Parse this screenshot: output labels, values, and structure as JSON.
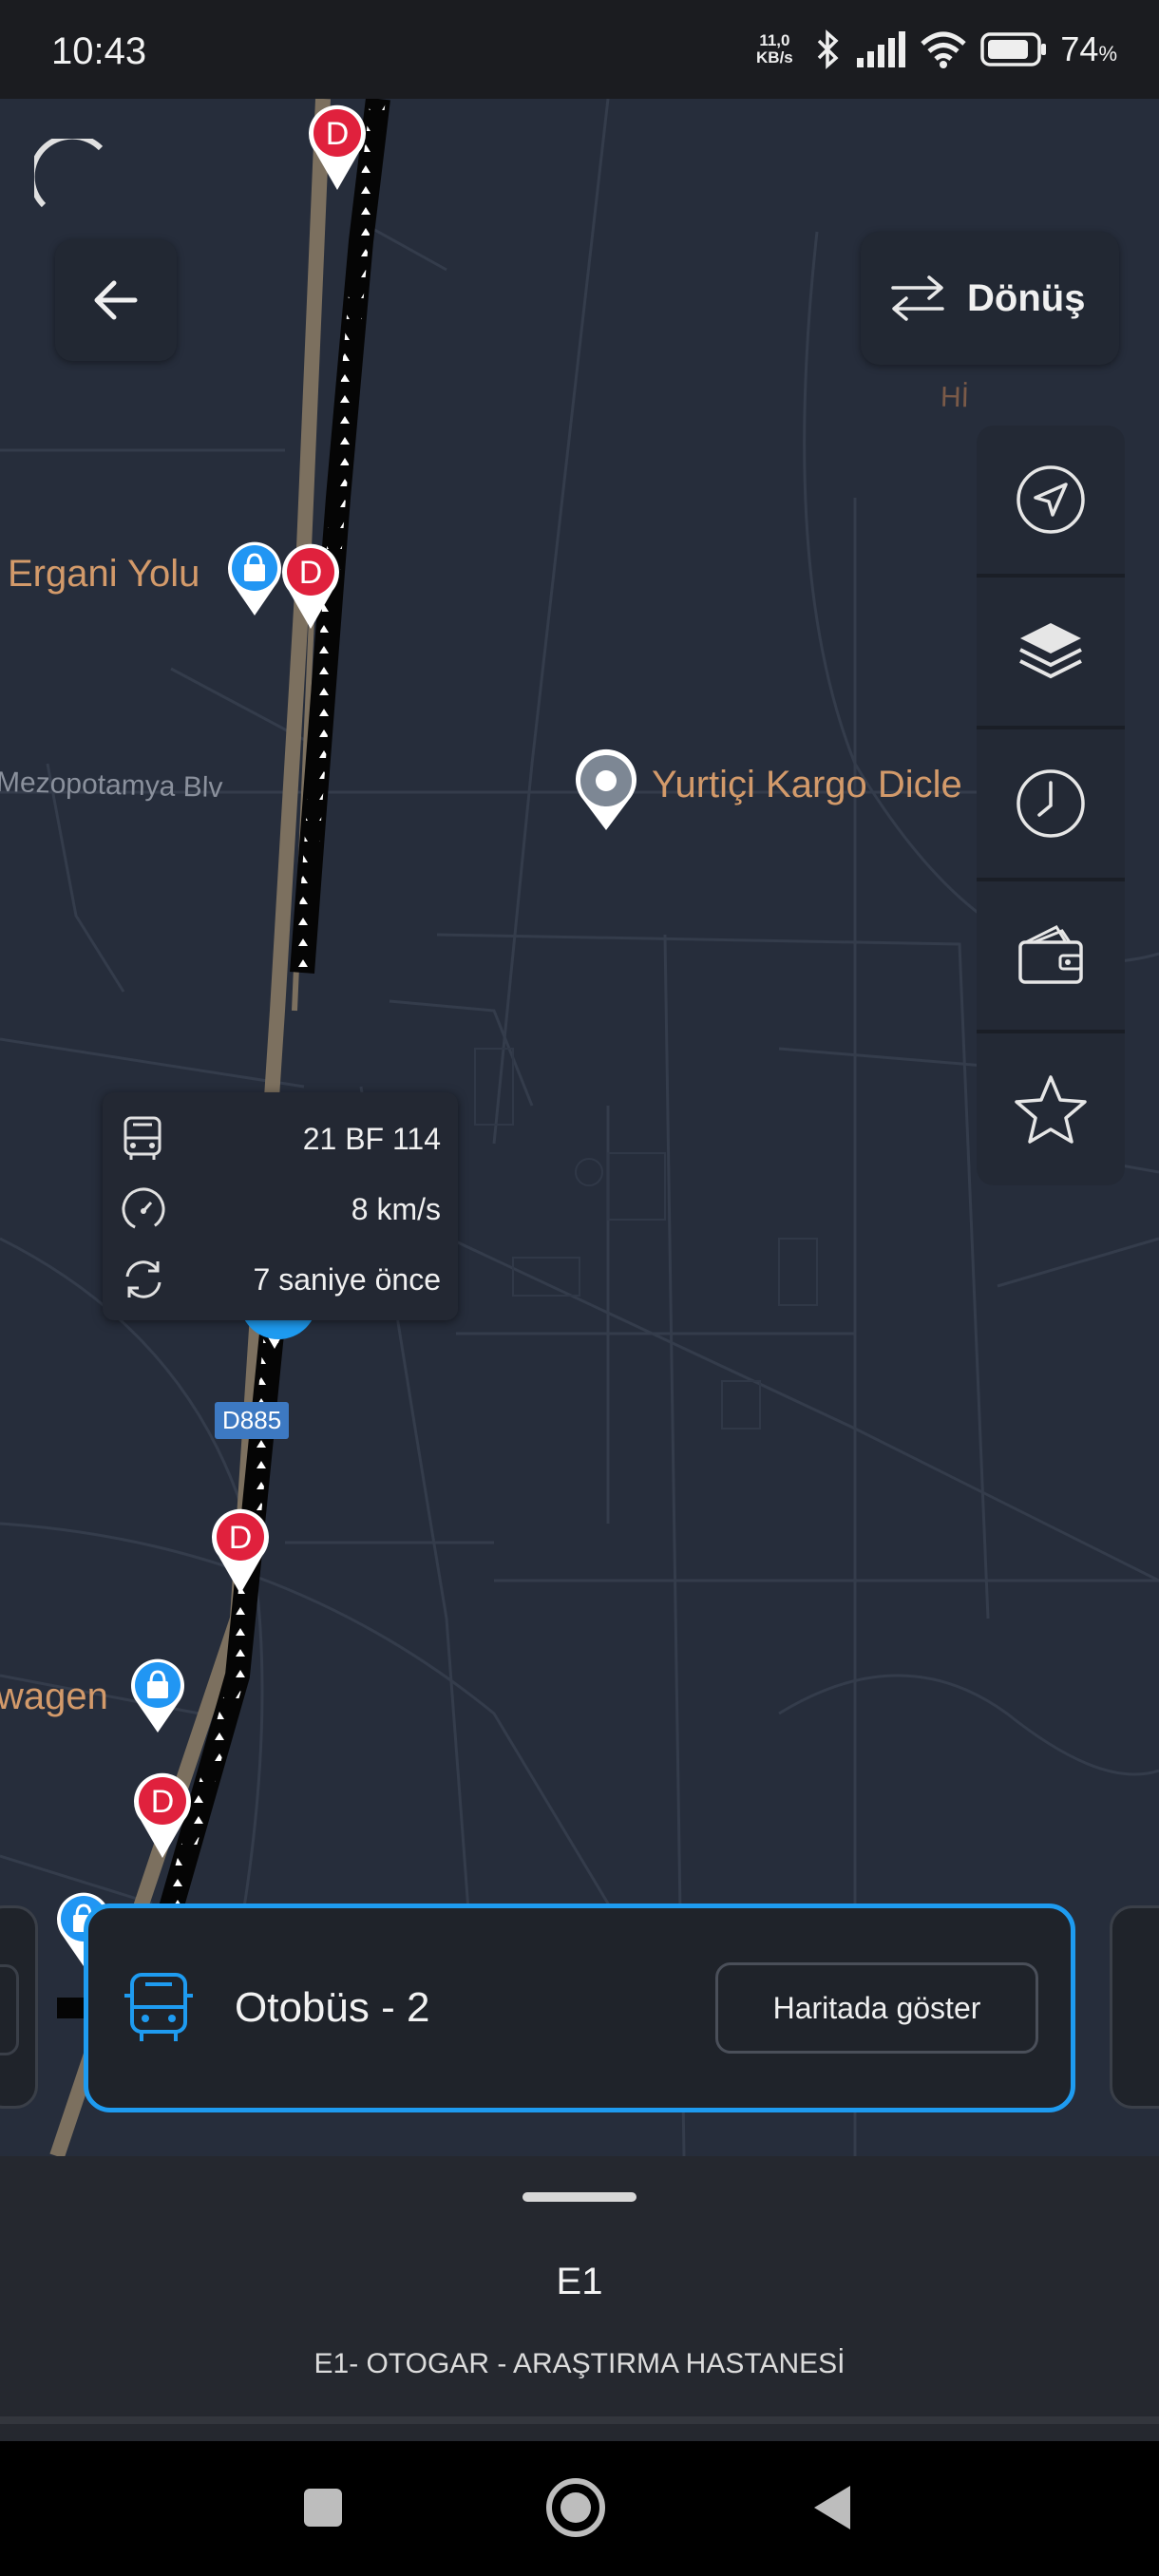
{
  "status_bar": {
    "time": "10:43",
    "net_speed_value": "11,0",
    "net_speed_unit": "KB/s",
    "battery_pct": "74",
    "battery_unit": "%"
  },
  "map": {
    "labels": {
      "ergani": "Ergani Yolu",
      "mezopotamya": "Mezopotamya Blv",
      "yurtici": "Yurtiçi Kargo Dicle",
      "wagen": "wagen",
      "hi": "Hİ",
      "road_code": "D885"
    },
    "stop_letter": "D"
  },
  "top_bar": {
    "return_label": "Dönüş"
  },
  "vehicle_popup": {
    "plate": "21 BF 114",
    "speed": "8 km/s",
    "updated": "7 saniye önce"
  },
  "bus_card": {
    "title": "Otobüs - 2",
    "show_on_map": "Haritada göster"
  },
  "route_sheet": {
    "code": "E1",
    "name": "E1- OTOGAR - ARAŞTIRMA HASTANESİ"
  },
  "colors": {
    "accent": "#1e9bf0",
    "stop_red": "#e0213d",
    "map_bg": "#262d3b",
    "label_orange": "#d39a6a"
  }
}
